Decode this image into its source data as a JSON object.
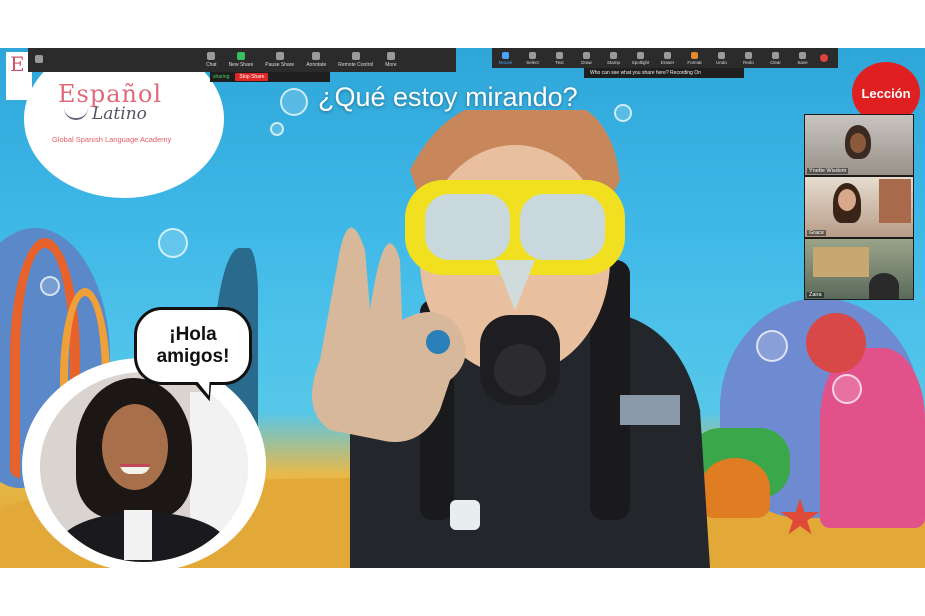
{
  "share_toolbar": {
    "items": [
      {
        "label": "Chat",
        "icon": "chat-icon"
      },
      {
        "label": "New Share",
        "icon": "new-share-icon"
      },
      {
        "label": "Pause Share",
        "icon": "pause-icon"
      },
      {
        "label": "Annotate",
        "icon": "pencil-icon"
      },
      {
        "label": "Remote Control",
        "icon": "mouse-icon"
      },
      {
        "label": "More",
        "icon": "more-icon"
      }
    ],
    "status_text": "sharing",
    "stop_label": "Stop Share"
  },
  "annotation_toolbar": {
    "items": [
      {
        "label": "Mouse",
        "icon": "cursor-icon",
        "active": true
      },
      {
        "label": "Select",
        "icon": "select-icon"
      },
      {
        "label": "Text",
        "icon": "text-icon"
      },
      {
        "label": "Draw",
        "icon": "draw-icon"
      },
      {
        "label": "Stamp",
        "icon": "stamp-icon"
      },
      {
        "label": "Spotlight",
        "icon": "spotlight-icon"
      },
      {
        "label": "Eraser",
        "icon": "eraser-icon"
      },
      {
        "label": "Format",
        "icon": "format-icon"
      },
      {
        "label": "Undo",
        "icon": "undo-icon"
      },
      {
        "label": "Redo",
        "icon": "redo-icon"
      },
      {
        "label": "Clear",
        "icon": "trash-icon"
      },
      {
        "label": "Save",
        "icon": "save-icon"
      }
    ],
    "recording_text": "Who can see what you share here? Recording On"
  },
  "logo": {
    "edge_letter": "E",
    "title": "Español",
    "subtitle": "Latino",
    "tagline": "Global Spanish Language Academy"
  },
  "slide": {
    "question": "¿Qué estoy mirando?",
    "badge": "Lección"
  },
  "speech_bubble": {
    "line1": "¡Hola",
    "line2": "amigos!"
  },
  "participants": [
    {
      "name": "Ynette Wisdom"
    },
    {
      "name": "Grace"
    },
    {
      "name": "Zaira"
    }
  ],
  "colors": {
    "accent_red": "#e02020",
    "logo_pink": "#e06a78",
    "ocean": "#3db6e6",
    "mask_yellow": "#f0e020"
  }
}
